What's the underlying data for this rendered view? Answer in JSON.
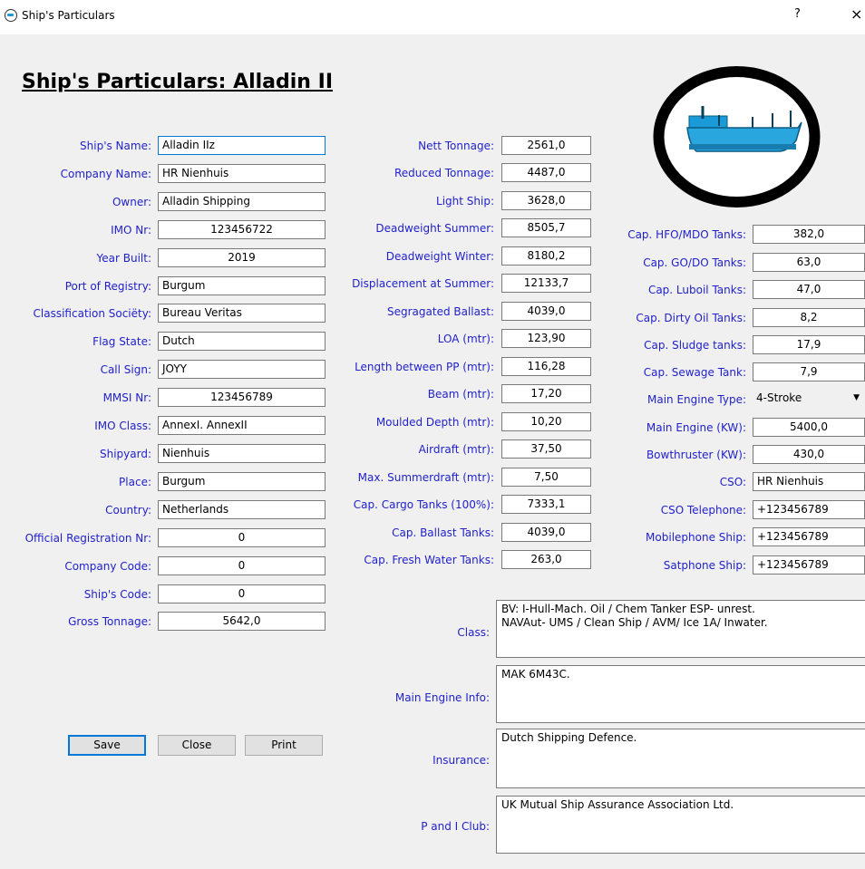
{
  "window": {
    "title": "Ship's Particulars",
    "help": "?",
    "close": "×"
  },
  "header": {
    "title": "Ship's Particulars: Alladin II"
  },
  "left": {
    "ships_name": {
      "label": "Ship's Name:",
      "value": "Alladin IIz"
    },
    "company_name": {
      "label": "Company Name:",
      "value": "HR Nienhuis"
    },
    "owner": {
      "label": "Owner:",
      "value": "Alladin Shipping"
    },
    "imo_nr": {
      "label": "IMO Nr:",
      "value": "123456722"
    },
    "year_built": {
      "label": "Year Built:",
      "value": "2019"
    },
    "port_of_registry": {
      "label": "Port of Registry:",
      "value": "Burgum"
    },
    "classification_society": {
      "label": "Classification Sociëty:",
      "value": "Bureau Veritas"
    },
    "flag_state": {
      "label": "Flag State:",
      "value": "Dutch"
    },
    "call_sign": {
      "label": "Call Sign:",
      "value": "JOYY"
    },
    "mmsi_nr": {
      "label": "MMSI Nr:",
      "value": "123456789"
    },
    "imo_class": {
      "label": "IMO Class:",
      "value": "AnnexI. AnnexII"
    },
    "shipyard": {
      "label": "Shipyard:",
      "value": "Nienhuis"
    },
    "place": {
      "label": "Place:",
      "value": "Burgum"
    },
    "country": {
      "label": "Country:",
      "value": "Netherlands"
    },
    "official_registration_nr": {
      "label": "Official Registration Nr:",
      "value": "0"
    },
    "company_code": {
      "label": "Company Code:",
      "value": "0"
    },
    "ships_code": {
      "label": "Ship's Code:",
      "value": "0"
    },
    "gross_tonnage": {
      "label": "Gross Tonnage:",
      "value": "5642,0"
    }
  },
  "middle": {
    "nett_tonnage": {
      "label": "Nett Tonnage:",
      "value": "2561,0"
    },
    "reduced_tonnage": {
      "label": "Reduced Tonnage:",
      "value": "4487,0"
    },
    "light_ship": {
      "label": "Light Ship:",
      "value": "3628,0"
    },
    "deadweight_summer": {
      "label": "Deadweight Summer:",
      "value": "8505,7"
    },
    "deadweight_winter": {
      "label": "Deadweight Winter:",
      "value": "8180,2"
    },
    "displacement_summer": {
      "label": "Displacement at Summer:",
      "value": "12133,7"
    },
    "segregated_ballast": {
      "label": "Segragated Ballast:",
      "value": "4039,0"
    },
    "loa": {
      "label": "LOA (mtr):",
      "value": "123,90"
    },
    "length_pp": {
      "label": "Length between PP (mtr):",
      "value": "116,28"
    },
    "beam": {
      "label": "Beam (mtr):",
      "value": "17,20"
    },
    "moulded_depth": {
      "label": "Moulded Depth (mtr):",
      "value": "10,20"
    },
    "airdraft": {
      "label": "Airdraft (mtr):",
      "value": "37,50"
    },
    "max_summerdraft": {
      "label": "Max. Summerdraft (mtr):",
      "value": "7,50"
    },
    "cap_cargo_tanks": {
      "label": "Cap. Cargo Tanks (100%):",
      "value": "7333,1"
    },
    "cap_ballast_tanks": {
      "label": "Cap. Ballast Tanks:",
      "value": "4039,0"
    },
    "cap_fresh_water": {
      "label": "Cap. Fresh Water Tanks:",
      "value": "263,0"
    }
  },
  "right": {
    "cap_hfo_mdo": {
      "label": "Cap. HFO/MDO Tanks:",
      "value": "382,0"
    },
    "cap_go_do": {
      "label": "Cap. GO/DO Tanks:",
      "value": "63,0"
    },
    "cap_luboil": {
      "label": "Cap. Luboil Tanks:",
      "value": "47,0"
    },
    "cap_dirty_oil": {
      "label": "Cap. Dirty Oil Tanks:",
      "value": "8,2"
    },
    "cap_sludge": {
      "label": "Cap. Sludge tanks:",
      "value": "17,9"
    },
    "cap_sewage": {
      "label": "Cap. Sewage Tank:",
      "value": "7,9"
    },
    "main_engine_type": {
      "label": "Main Engine Type:",
      "value": "4-Stroke"
    },
    "main_engine_kw": {
      "label": "Main Engine (KW):",
      "value": "5400,0"
    },
    "bowthruster_kw": {
      "label": "Bowthruster (KW):",
      "value": "430,0"
    },
    "cso": {
      "label": "CSO:",
      "value": "HR Nienhuis"
    },
    "cso_telephone": {
      "label": "CSO Telephone:",
      "value": "+123456789"
    },
    "mobilephone_ship": {
      "label": "Mobilephone Ship:",
      "value": "+123456789"
    },
    "satphone_ship": {
      "label": "Satphone Ship:",
      "value": "+123456789"
    }
  },
  "memos": {
    "class": {
      "label": "Class:",
      "value": "BV: I-Hull-Mach. Oil / Chem Tanker ESP- unrest.\n NAVAut- UMS / Clean Ship / AVM/ Ice 1A/ Inwater."
    },
    "main_engine_info": {
      "label": "Main Engine Info:",
      "value": "MAK 6M43C."
    },
    "insurance": {
      "label": "Insurance:",
      "value": "Dutch Shipping Defence."
    },
    "p_and_i_club": {
      "label": "P and I Club:",
      "value": "UK Mutual Ship Assurance Association Ltd."
    }
  },
  "buttons": {
    "save": "Save",
    "close": "Close",
    "print": "Print"
  },
  "icons": {
    "app": "ship-app-icon",
    "logo": "ship-logo-icon",
    "dropdown": "chevron-down-icon"
  },
  "colors": {
    "label": "#1f1fcc",
    "focus": "#0078d7",
    "ship_hull": "#1a9bd7"
  }
}
